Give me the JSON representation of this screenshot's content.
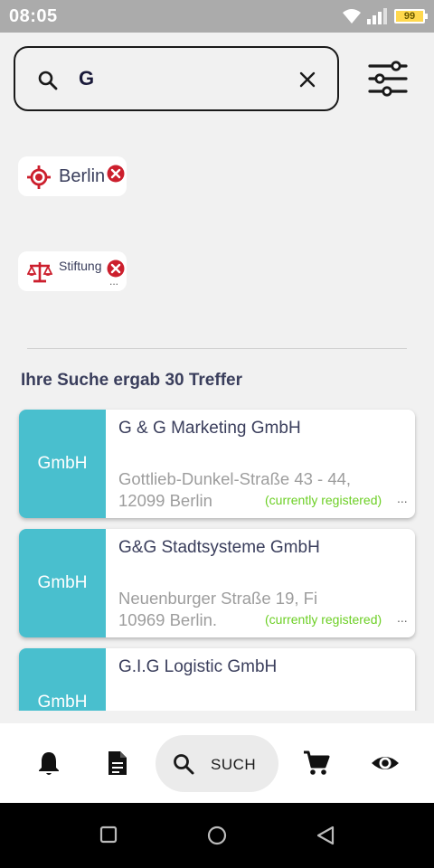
{
  "status_bar": {
    "time": "08:05",
    "battery_level": "99",
    "icons": [
      "wifi-icon",
      "signal-icon",
      "battery-icon"
    ]
  },
  "search": {
    "value": "G",
    "icons": {
      "search": "search-icon",
      "clear": "close-icon",
      "filter": "sliders-icon"
    }
  },
  "filters": {
    "chips": [
      {
        "label": "Berlin",
        "icon": "location-target-icon"
      },
      {
        "label": "Stiftung",
        "icon": "scales-icon"
      }
    ]
  },
  "results": {
    "count_text": "Ihre Suche ergab 30 Treffer",
    "items": [
      {
        "badge": "GmbH",
        "name": "G & G Marketing GmbH",
        "address_line1": "Gottlieb-Dunkel-Straße 43 - 44,",
        "address_line2": "12099 Berlin",
        "status": "(currently registered)",
        "more": "..."
      },
      {
        "badge": "GmbH",
        "name": "G&G Stadtsysteme GmbH",
        "address_line1": "Neuenburger Straße 19,   Fi",
        "address_line2": "10969 Berlin.",
        "status": "(currently registered)",
        "more": "..."
      },
      {
        "badge": "GmbH",
        "name": "G.I.G Logistic GmbH",
        "address_line1": "",
        "address_line2": "",
        "status": "",
        "more": ""
      }
    ]
  },
  "bottom_nav": {
    "items": [
      {
        "icon": "bell-icon"
      },
      {
        "icon": "document-icon"
      },
      {
        "icon": "search-icon",
        "label": "SUCH",
        "active": true
      },
      {
        "icon": "cart-icon"
      },
      {
        "icon": "eye-icon"
      }
    ]
  },
  "colors": {
    "accent_teal": "#49bfce",
    "status_green": "#6ccf24",
    "chip_red": "#cc1f2d",
    "text_dark": "#3a3e5c"
  }
}
